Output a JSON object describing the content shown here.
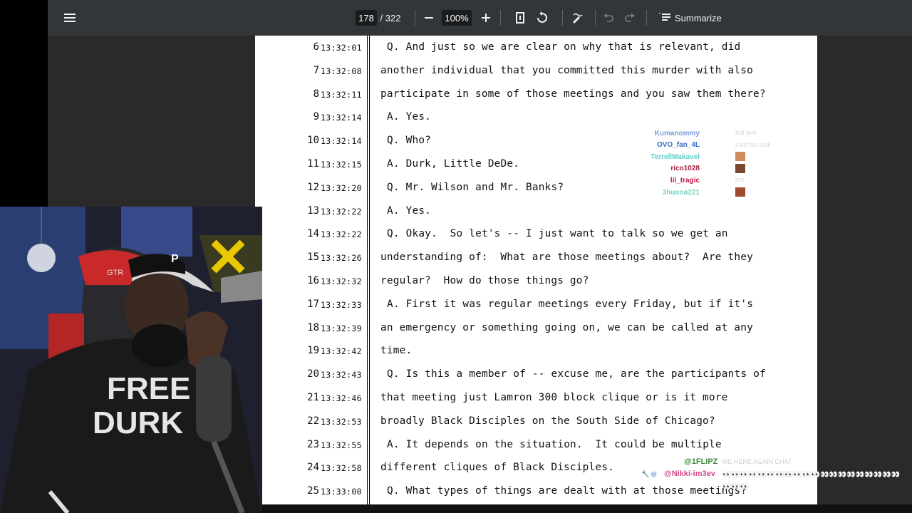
{
  "toolbar": {
    "current_page": "178",
    "total_pages": "/ 322",
    "zoom": "100%",
    "summarize_label": "Summarize"
  },
  "transcript": {
    "lines": [
      {
        "n": "6",
        "t": "13:32:01",
        "text": "Q. And just so we are clear on why that is relevant, did",
        "indent": true
      },
      {
        "n": "7",
        "t": "13:32:08",
        "text": "another individual that you committed this murder with also",
        "indent": false
      },
      {
        "n": "8",
        "t": "13:32:11",
        "text": "participate in some of those meetings and you saw them there?",
        "indent": false
      },
      {
        "n": "9",
        "t": "13:32:14",
        "text": "A. Yes.",
        "indent": true
      },
      {
        "n": "10",
        "t": "13:32:14",
        "text": "Q. Who?",
        "indent": true
      },
      {
        "n": "11",
        "t": "13:32:15",
        "text": "A. Durk, Little DeDe.",
        "indent": true
      },
      {
        "n": "12",
        "t": "13:32:20",
        "text": "Q. Mr. Wilson and Mr. Banks?",
        "indent": true
      },
      {
        "n": "13",
        "t": "13:32:22",
        "text": "A. Yes.",
        "indent": true
      },
      {
        "n": "14",
        "t": "13:32:22",
        "text": "Q. Okay.  So let's -- I just want to talk so we get an",
        "indent": true
      },
      {
        "n": "15",
        "t": "13:32:26",
        "text": "understanding of:  What are those meetings about?  Are they",
        "indent": false
      },
      {
        "n": "16",
        "t": "13:32:32",
        "text": "regular?  How do those things go?",
        "indent": false
      },
      {
        "n": "17",
        "t": "13:32:33",
        "text": "A. First it was regular meetings every Friday, but if it's",
        "indent": true
      },
      {
        "n": "18",
        "t": "13:32:39",
        "text": "an emergency or something going on, we can be called at any",
        "indent": false
      },
      {
        "n": "19",
        "t": "13:32:42",
        "text": "time.",
        "indent": false
      },
      {
        "n": "20",
        "t": "13:32:43",
        "text": "Q. Is this a member of -- excuse me, are the participants of",
        "indent": true
      },
      {
        "n": "21",
        "t": "13:32:46",
        "text": "that meeting just Lamron 300 block clique or is it more",
        "indent": false
      },
      {
        "n": "22",
        "t": "13:32:53",
        "text": "broadly Black Disciples on the South Side of Chicago?",
        "indent": false
      },
      {
        "n": "23",
        "t": "13:32:55",
        "text": "A. It depends on the situation.  It could be multiple",
        "indent": true
      },
      {
        "n": "24",
        "t": "13:32:58",
        "text": "different cliques of Black Disciples.",
        "indent": false
      },
      {
        "n": "25",
        "t": "13:33:00",
        "text": "Q. What types of things are dealt with at those meetings?",
        "indent": true
      }
    ]
  },
  "chat_overlay": {
    "messages": [
      {
        "user": "Kumanommy",
        "color": "#7d9bd6",
        "msg": "fed jam"
      },
      {
        "user": "OVO_fan_4L",
        "color": "#3a6fc2",
        "msg": "sold his soul"
      },
      {
        "user": "TerrellMakavel",
        "color": "#5fd0c8",
        "msg": ""
      },
      {
        "user": "rico1028",
        "color": "#a01c3a",
        "msg": ""
      },
      {
        "user": "lil_tragic",
        "color": "#c01c4a",
        "msg": "bro"
      },
      {
        "user": "3hunna221",
        "color": "#7ecfc0",
        "msg": ""
      }
    ],
    "bottom": [
      {
        "user": "@1FLIPZ",
        "color": "#3c8a3c",
        "msg": "WE HERE AGAIN CHAT"
      },
      {
        "user": "@Nikki-im3ev",
        "color": "#d04a8c",
        "msg": "👀👀👀👀👀👀👀👀👀👀👀👀👀👀👀👀👀👀👀👀👀👀👀"
      }
    ]
  },
  "webcam": {
    "shirt_text_1": "FREE",
    "shirt_text_2": "DURK"
  },
  "colors": {
    "toolbar_bg": "#323639",
    "viewer_bg": "#2a2a2a",
    "page_bg": "#ffffff"
  }
}
